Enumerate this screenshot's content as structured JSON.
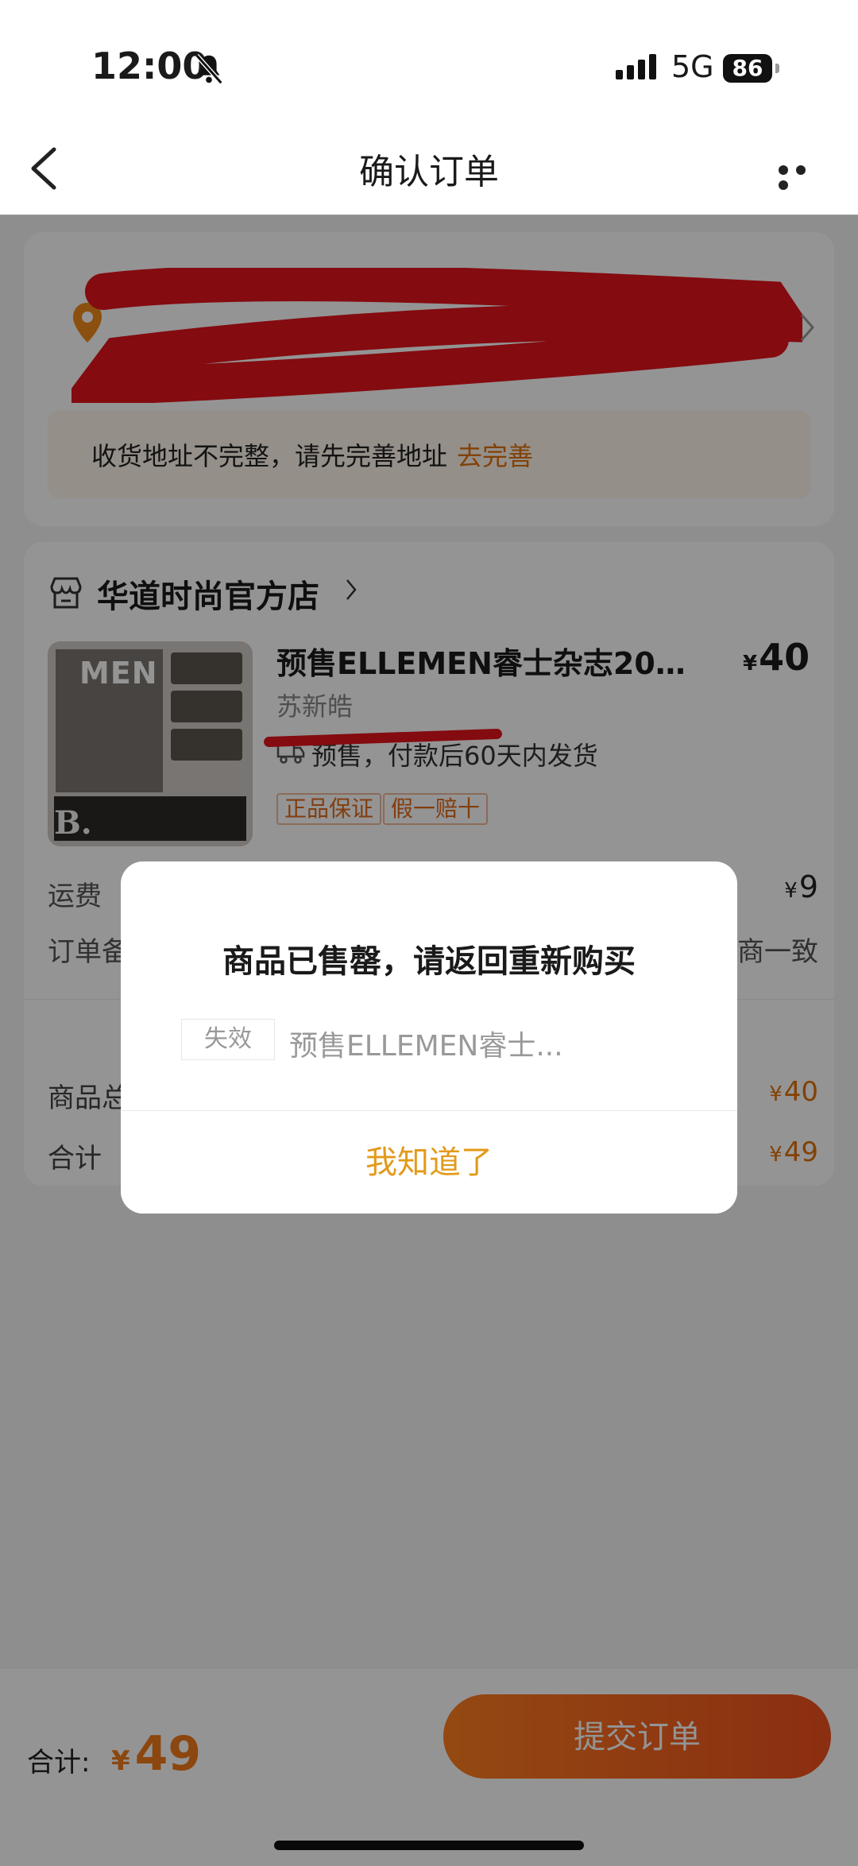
{
  "status_bar": {
    "time": "12:00",
    "network": "5G",
    "battery": "86"
  },
  "nav": {
    "title": "确认订单",
    "back_icon": "chevron-left-icon",
    "more_icon": "more-dots-icon"
  },
  "address": {
    "warning_text": "收货地址不完整，请先完善地址",
    "warning_link": "去完善"
  },
  "store": {
    "name": "华道时尚官方店",
    "product": {
      "title": "预售ELLEMEN睿士杂志2025...",
      "spec": "苏新皓",
      "price_symbol": "¥",
      "price": "40",
      "shipping": "预售，付款后60天内发货",
      "tags": [
        "正品保证",
        "假一赔十"
      ],
      "image_logo": "MEN",
      "image_mark": "B."
    },
    "rows": [
      {
        "label": "运费",
        "value": "9"
      },
      {
        "label": "订单备注",
        "value": "商一致"
      }
    ],
    "summary": [
      {
        "label": "商品总价",
        "value": "40"
      },
      {
        "label": "合计",
        "value": "49"
      }
    ]
  },
  "bottom": {
    "total_label": "合计:",
    "total_symbol": "¥",
    "total_value": "49",
    "submit_label": "提交订单"
  },
  "dialog": {
    "title": "商品已售罄，请返回重新购买",
    "badge": "失效",
    "item_title": "预售ELLEMEN睿士...",
    "button": "我知道了"
  },
  "colors": {
    "accent": "#f0501e",
    "link": "#e0700a",
    "dialog_button": "#e39a1a",
    "redaction": "#e4141c"
  }
}
